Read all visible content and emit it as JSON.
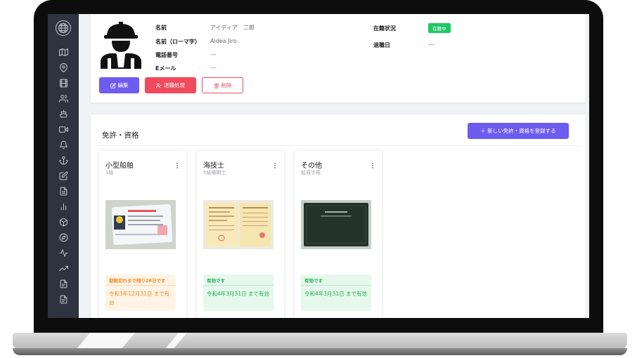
{
  "profile": {
    "name_label": "名前",
    "name_value": "アイディア　二郎",
    "romaji_label": "名前（ローマ字）",
    "romaji_value": "Aidea Jiro",
    "phone_label": "電話番号",
    "phone_value": "---",
    "email_label": "Eメール",
    "email_value": "---",
    "employment_label": "在籍状況",
    "employment_status": "在籍中",
    "retire_date_label": "退職日",
    "retire_date_value": "---",
    "edit_label": "編集",
    "retire_label": "退職処理",
    "delete_label": "削除"
  },
  "licenses": {
    "title": "免許・資格",
    "add_label": "＋ 新しい免許・資格を登録する",
    "cards": [
      {
        "title": "小型船舶",
        "subtitle": "1級",
        "status": "期限切れまで残り28日です",
        "expiry": "令和3年12月31日 まで有効",
        "state": "warning"
      },
      {
        "title": "海技士",
        "subtitle": "5級機関士",
        "status": "有効です",
        "expiry": "令和4年3月31日 まで有効",
        "state": "valid"
      },
      {
        "title": "その他",
        "subtitle": "船員手帳",
        "status": "有効です",
        "expiry": "令和4年3月31日 まで有効",
        "state": "valid"
      }
    ]
  },
  "icons": {
    "sidebar": [
      "logo-globe-icon",
      "map-icon",
      "location-pin-icon",
      "film-icon",
      "users-icon",
      "ship-icon",
      "video-icon",
      "bell-icon",
      "anchor-icon",
      "edit-icon",
      "document-icon",
      "bar-chart-icon",
      "box-icon",
      "compass-icon",
      "activity-icon",
      "trending-up-icon",
      "file-icon",
      "file-icon"
    ]
  },
  "colors": {
    "primary": "#6e5bf0",
    "danger": "#f04a5c",
    "success": "#1ec862",
    "warning": "#f08a24",
    "sidebar": "#2e3340"
  }
}
